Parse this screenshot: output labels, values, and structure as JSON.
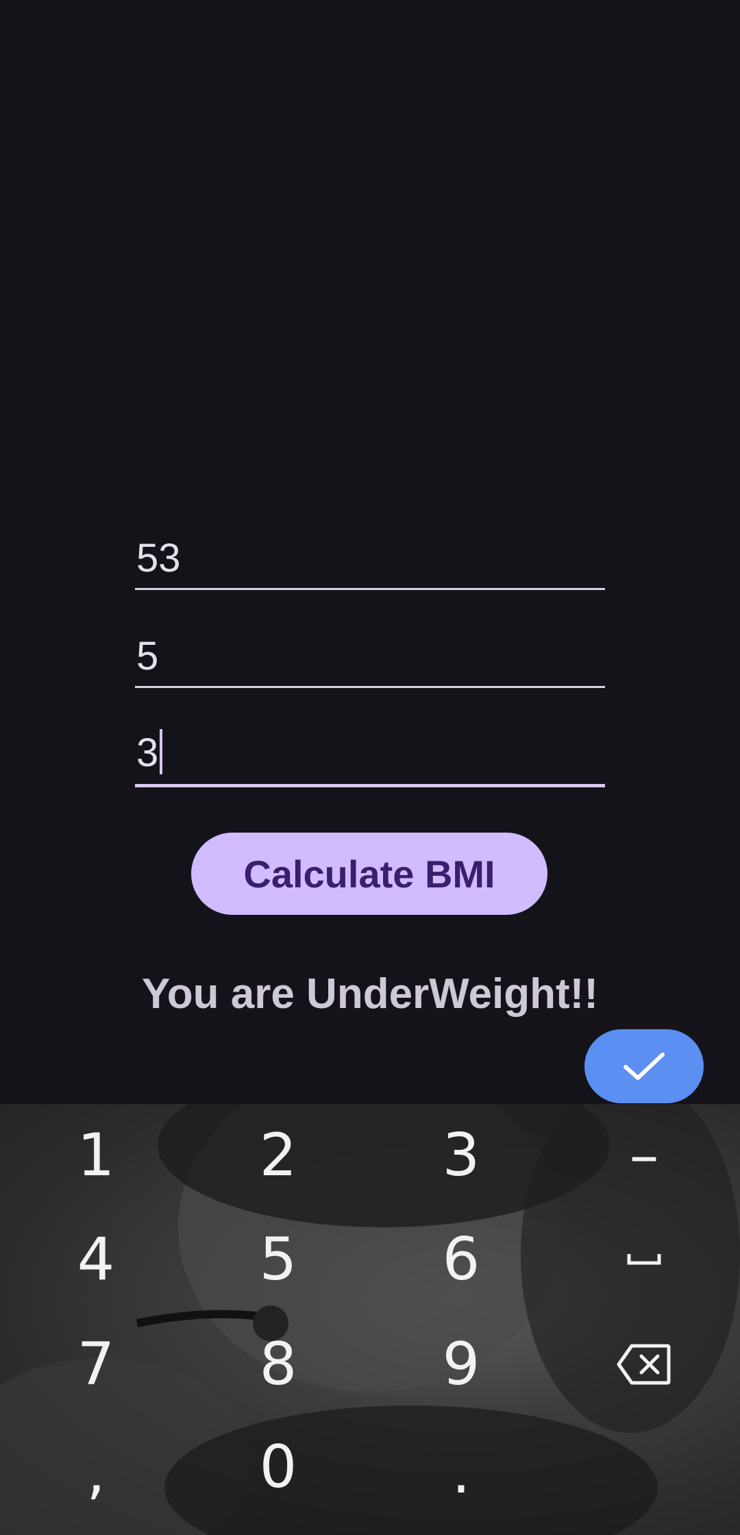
{
  "form": {
    "weight_value": "53",
    "height_feet_value": "5",
    "height_inches_value": "3"
  },
  "actions": {
    "calculate_label": "Calculate BMI"
  },
  "result": {
    "message": "You are UnderWeight!!"
  },
  "keyboard": {
    "keys": [
      "1",
      "2",
      "3",
      "–",
      "4",
      "5",
      "6",
      "space",
      "7",
      "8",
      "9",
      "backspace",
      ",",
      "0",
      ".",
      "done"
    ],
    "key_1": "1",
    "key_2": "2",
    "key_3": "3",
    "key_dash": "–",
    "key_4": "4",
    "key_5": "5",
    "key_6": "6",
    "key_7": "7",
    "key_8": "8",
    "key_9": "9",
    "key_comma": ",",
    "key_0": "0",
    "key_period": ".",
    "accent_color": "#5b8ff2"
  },
  "colors": {
    "background": "#15131a",
    "button": "#d0bcff",
    "button_text": "#3a1f6e"
  }
}
